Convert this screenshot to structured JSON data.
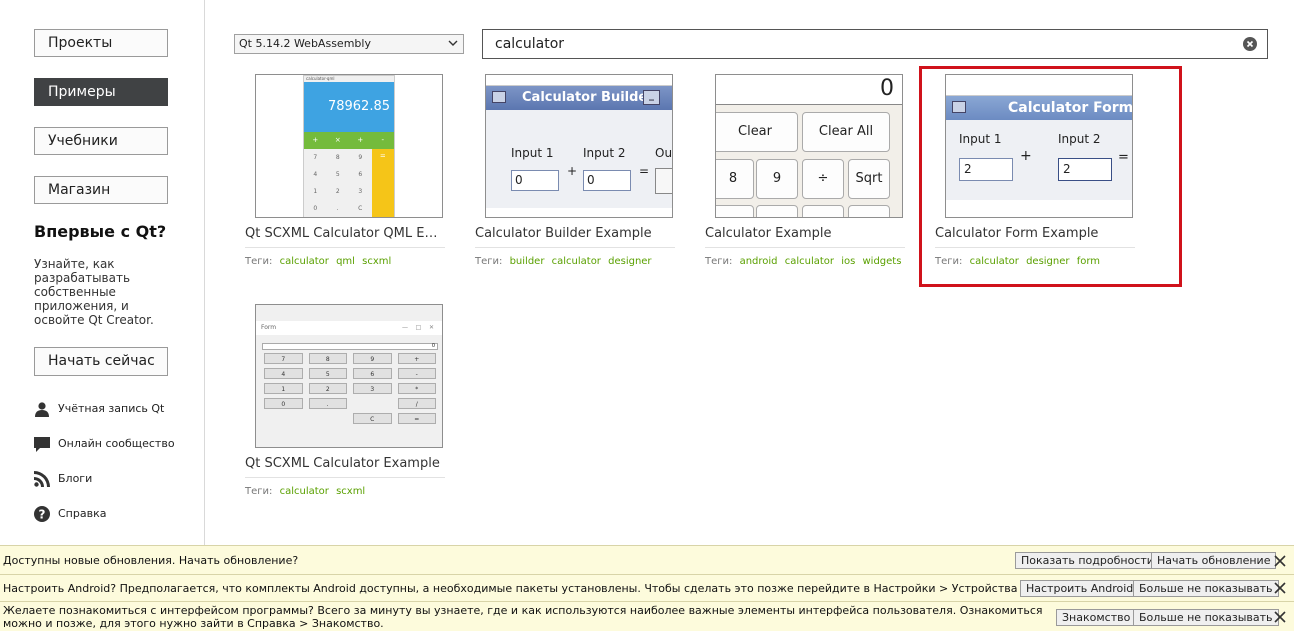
{
  "sidebar": {
    "buttons": [
      {
        "label": "Проекты",
        "active": false
      },
      {
        "label": "Примеры",
        "active": true
      },
      {
        "label": "Учебники",
        "active": false
      },
      {
        "label": "Магазин",
        "active": false
      }
    ],
    "new_title": "Впервые с Qt?",
    "new_desc": "Узнайте, как разрабатывать собственные приложения, и освойте Qt Creator.",
    "start_button": "Начать сейчас",
    "links": [
      {
        "label": "Учётная запись Qt",
        "icon": "user-icon"
      },
      {
        "label": "Онлайн сообщество",
        "icon": "chat-icon"
      },
      {
        "label": "Блоги",
        "icon": "rss-icon"
      },
      {
        "label": "Справка",
        "icon": "help-icon"
      }
    ]
  },
  "filter": {
    "version": "Qt 5.14.2 WebAssembly",
    "search_value": "calculator"
  },
  "tags_label": "Теги:",
  "examples": [
    {
      "title": "Qt SCXML Calculator QML Exa...",
      "tags": [
        "calculator",
        "qml",
        "scxml"
      ]
    },
    {
      "title": "Calculator Builder Example",
      "tags": [
        "builder",
        "calculator",
        "designer"
      ]
    },
    {
      "title": "Calculator Example",
      "tags": [
        "android",
        "calculator",
        "ios",
        "widgets"
      ]
    },
    {
      "title": "Calculator Form Example",
      "tags": [
        "calculator",
        "designer",
        "form"
      ]
    },
    {
      "title": "Qt SCXML Calculator Example",
      "tags": [
        "calculator",
        "scxml"
      ]
    }
  ],
  "thumbs": {
    "qml": {
      "window_title": "calculator-qml",
      "display": "78962.85",
      "ops": [
        "+",
        "×",
        "+",
        "-"
      ],
      "keys": [
        "7",
        "8",
        "9",
        "4",
        "5",
        "6",
        "1",
        "2",
        "3",
        "0",
        ".",
        "C"
      ],
      "equals": "="
    },
    "builder": {
      "title": "Calculator Builder",
      "input1": "Input 1",
      "input2": "Input 2",
      "output": "Out",
      "v1": "0",
      "v2": "0",
      "plus": "+",
      "eq": "="
    },
    "calc": {
      "display": "0",
      "clear": "Clear",
      "clear_all": "Clear All",
      "keys": [
        "8",
        "9",
        "÷",
        "Sqrt"
      ]
    },
    "form": {
      "title": "Calculator Form",
      "input1": "Input 1",
      "input2": "Input 2",
      "v1": "2",
      "v2": "2",
      "plus": "+",
      "eq": "="
    },
    "scxml": {
      "window_title": "Form",
      "display": "0",
      "keys": [
        "7",
        "8",
        "9",
        "+",
        "4",
        "5",
        "6",
        "-",
        "1",
        "2",
        "3",
        "*",
        "0",
        ".",
        "",
        "/",
        "",
        "",
        "C",
        "="
      ]
    }
  },
  "notifications": [
    {
      "message": "Доступны новые обновления. Начать обновление?",
      "buttons": [
        "Показать подробности",
        "Начать обновление"
      ]
    },
    {
      "message": "Настроить Android? Предполагается, что комплекты Android доступны, а необходимые пакеты установлены. Чтобы сделать это позже перейдите в Настройки > Устройства > Android.",
      "buttons": [
        "Настроить Android",
        "Больше не показывать"
      ]
    },
    {
      "message": "Желаете познакомиться с интерфейсом программы? Всего за минуту вы узнаете, где и как используются наиболее важные элементы интерфейса пользователя. Ознакомиться можно и позже, для этого нужно зайти в Справка > Знакомство.",
      "buttons": [
        "Знакомство",
        "Больше не показывать"
      ]
    }
  ],
  "colors": {
    "accent_tag": "#5aa000",
    "highlight": "#d0121b",
    "active_nav": "#404244",
    "info_bar": "#fdfbdc"
  }
}
